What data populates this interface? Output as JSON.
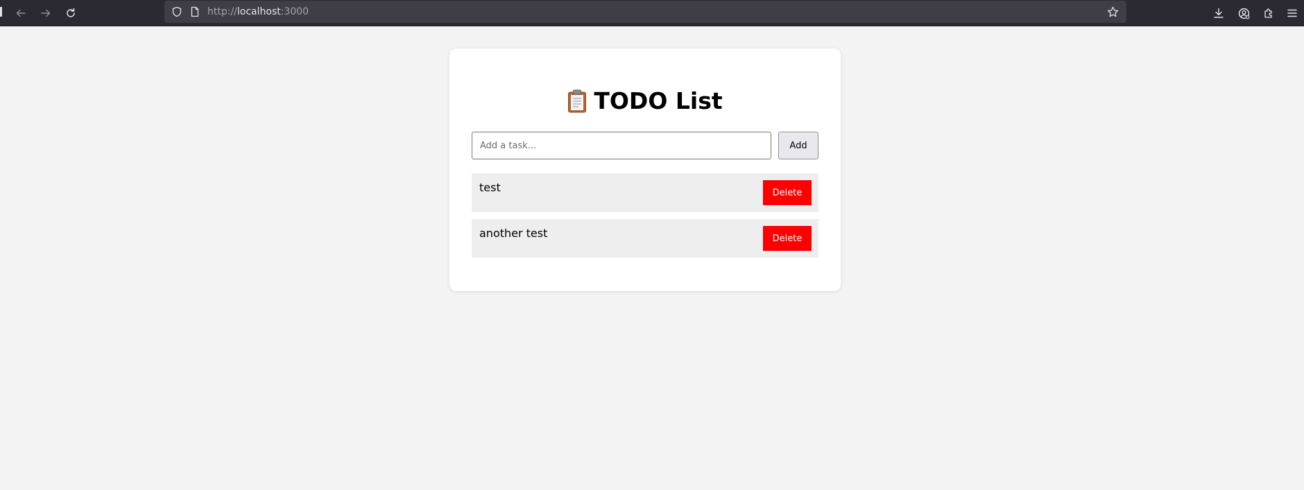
{
  "browser": {
    "url_scheme": "http://",
    "url_host": "localhost",
    "url_port": ":3000",
    "icons": {
      "back": "arrow-left-icon",
      "forward": "arrow-right-icon",
      "reload": "reload-icon",
      "site_info": "shield-icon",
      "page": "page-icon",
      "bookmark": "star-icon",
      "downloads": "download-icon",
      "account": "account-icon",
      "extensions": "puzzle-icon",
      "menu": "hamburger-menu-icon"
    }
  },
  "app": {
    "title_icon": "clipboard-icon",
    "title": "TODO List",
    "input_placeholder": "Add a task...",
    "input_value": "",
    "add_label": "Add",
    "tasks": [
      {
        "text": "test",
        "delete_label": "Delete"
      },
      {
        "text": "another test",
        "delete_label": "Delete"
      }
    ]
  },
  "colors": {
    "page_background": "#f3f3f3",
    "card_background": "#ffffff",
    "task_background": "#eeeeee",
    "delete_button": "#ff0000",
    "add_button": "#e9e9ed",
    "chrome_toolbar": "#2b2a33",
    "chrome_urlbar": "#3f3e46"
  }
}
